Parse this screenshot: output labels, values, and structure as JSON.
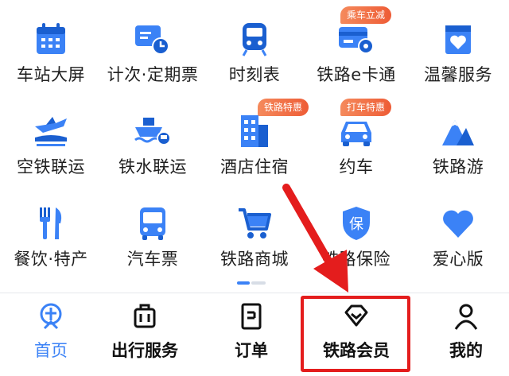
{
  "services": [
    {
      "label": "车站大屏",
      "icon": "calendar-board-icon"
    },
    {
      "label": "计次·定期票",
      "icon": "ticket-clock-icon"
    },
    {
      "label": "时刻表",
      "icon": "train-front-icon"
    },
    {
      "label": "铁路e卡通",
      "icon": "card-icon",
      "badge": "乘车立减"
    },
    {
      "label": "温馨服务",
      "icon": "heart-box-icon"
    },
    {
      "label": "空铁联运",
      "icon": "plane-train-icon"
    },
    {
      "label": "铁水联运",
      "icon": "ship-train-icon"
    },
    {
      "label": "酒店住宿",
      "icon": "hotel-icon",
      "badge": "铁路特惠"
    },
    {
      "label": "约车",
      "icon": "car-icon",
      "badge": "打车特惠"
    },
    {
      "label": "铁路游",
      "icon": "mountain-icon"
    },
    {
      "label": "餐饮·特产",
      "icon": "fork-knife-icon"
    },
    {
      "label": "汽车票",
      "icon": "bus-icon"
    },
    {
      "label": "铁路商城",
      "icon": "cart-icon"
    },
    {
      "label": "铁路保险",
      "icon": "shield-insurance-icon"
    },
    {
      "label": "爱心版",
      "icon": "heart-icon"
    }
  ],
  "insurance_icon_text": "保",
  "tabs": [
    {
      "label": "首页",
      "icon": "home-railway-icon",
      "active": true
    },
    {
      "label": "出行服务",
      "icon": "luggage-icon"
    },
    {
      "label": "订单",
      "icon": "order-icon"
    },
    {
      "label": "铁路会员",
      "icon": "diamond-icon"
    },
    {
      "label": "我的",
      "icon": "person-icon"
    }
  ],
  "colors": {
    "accent": "#3b82f6",
    "dark_blue": "#1a5fd0",
    "tag_orange": "#ee5c36",
    "highlight_red": "#e41d1d"
  }
}
